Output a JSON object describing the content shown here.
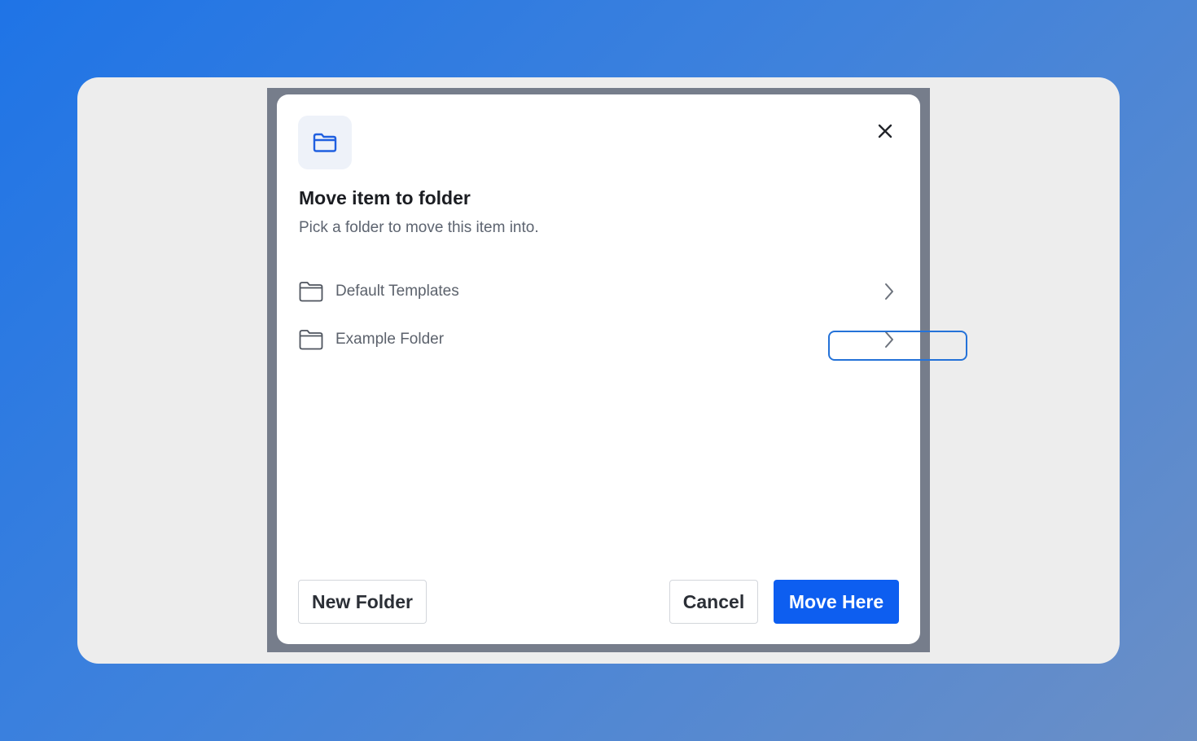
{
  "dialog": {
    "title": "Move item to folder",
    "subtitle": "Pick a folder to move this item into.",
    "header_icon": "folder-icon",
    "close_icon": "close-icon"
  },
  "folders": [
    {
      "label": "Default Templates",
      "icon": "folder-icon",
      "chevron": "chevron-right-icon"
    },
    {
      "label": "Example Folder",
      "icon": "folder-icon",
      "chevron": "chevron-right-icon"
    }
  ],
  "actions": {
    "new_folder_label": "New Folder",
    "cancel_label": "Cancel",
    "move_here_label": "Move Here"
  },
  "colors": {
    "primary": "#0d5ef0",
    "highlight": "#2472d8",
    "page_background": "#1f74e6"
  }
}
